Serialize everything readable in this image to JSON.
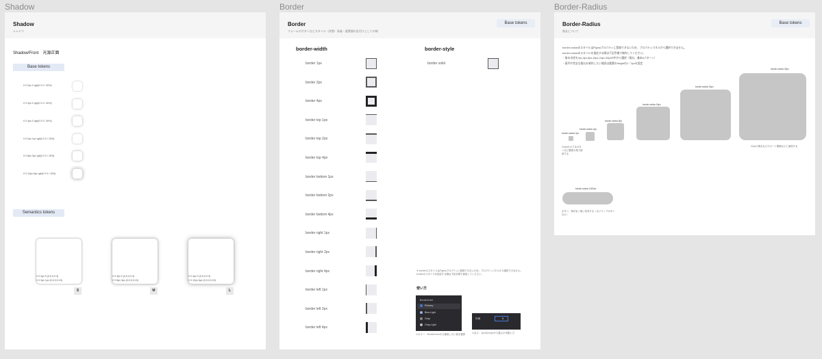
{
  "frames": {
    "shadow": "Shadow",
    "border": "Border",
    "radius": "Border-Radius"
  },
  "shadow_panel": {
    "title": "Shadow",
    "subtitle": "シャドウ",
    "section_title": "Shadow/Front　光源正面",
    "base_tokens_label": "Base tokens",
    "base_rows": [
      "0 0 2px 0 rgb(0 0 0 / 30%)",
      "0 0 3px 0 rgb(0 0 0 / 30%)",
      "0 0 4px 0 rgb(0 0 0 / 30%)",
      "0 0 2px 1px rgb(0 0 0 / 15%)",
      "0 0 8px 3px rgb(0 0 0 / 15%)",
      "0 0 12px 6px rgb(0 0 0 / 15%)"
    ],
    "semantics_label": "Semantics tokens",
    "semantics": [
      {
        "line1": "0 0 2px 0 (0,0,0,0.3)",
        "line2": "0 0 3px 1px (0,0,0,0.15)",
        "badge": "S"
      },
      {
        "line1": "0 0 3px 0 (0,0,0,0.3)",
        "line2": "0 0 8px 3px (0,0,0,0.15)",
        "badge": "M"
      },
      {
        "line1": "0 0 4px 0 (0,0,0,0.3)",
        "line2": "0 0 12px 6px (0,0,0,0.15)",
        "badge": "L"
      }
    ]
  },
  "border_panel": {
    "title": "Border",
    "subtitle": "フォームやボタンなどスタイル（状態）表者・要素間の区切りとしての線",
    "base_tokens_label": "Base tokens",
    "width_heading": "border-width",
    "style_heading": "border-style",
    "width_rows": [
      "border 1px",
      "border 2px",
      "border 4px",
      "border top 1px",
      "border top 2px",
      "border top 4px",
      "border bottom 1px",
      "border bottom 2px",
      "border bottom 4px",
      "border right 1px",
      "border right 2px",
      "border right 4px",
      "border left 1px",
      "border left 2px",
      "border left 4px"
    ],
    "style_rows": [
      "border solid"
    ],
    "note_line1": "※ borderのスタイルはFigmaプロパティに登録できないため、プロパティパネルから選択できません。",
    "note_line2": "borderのスタイルを指定する際は下記手順で使用してください。",
    "usage_label": "使い方",
    "color_panel": {
      "title": "BorderColor",
      "items": [
        "Primary",
        "Blue-Light",
        "Gray",
        "Gray-Light"
      ]
    },
    "caption_left": "①カラー：BorderColorから使用したい色を選択",
    "caption_right": "②太さ：1px/2px/4pxから選ぶか手動入力",
    "weight_label": "外側",
    "weight_value": "4"
  },
  "radius_panel": {
    "title": "Border-Radius",
    "subtitle": "角丸について",
    "base_tokens_label": "Base tokens",
    "desc": [
      "border-radiusのスタイルはFigmaプロパティに登録できないため、プロパティパネルから選択できません。",
      "border-radiusのスタイルを指定する際は下記手順で制作してください。",
      "・角の半径を2px,4px,8px,16px,24px,32pxの中から選択（角丸、基本6パターン）",
      "・直円や完全な角丸を制作したい場合は要素のheightの1／2pxを設定"
    ],
    "boxes": [
      {
        "label": "border-radius 2px"
      },
      {
        "label": "border-radius 4px"
      },
      {
        "label": "border-radius 8px"
      },
      {
        "label": "border-radius 16px"
      },
      {
        "label": "border-radius 24px"
      },
      {
        "label": "border-radius 32px"
      }
    ],
    "note_small_1": "2/4pxの小さなボタンなど要素の角で使用する",
    "note_large": "32pxの角丸などのカード要素などに使用する",
    "pill_label": "border-radius 1000px",
    "pill_note": "ボタン、角が全く無い形状する（ポジティブボタンなど）"
  }
}
